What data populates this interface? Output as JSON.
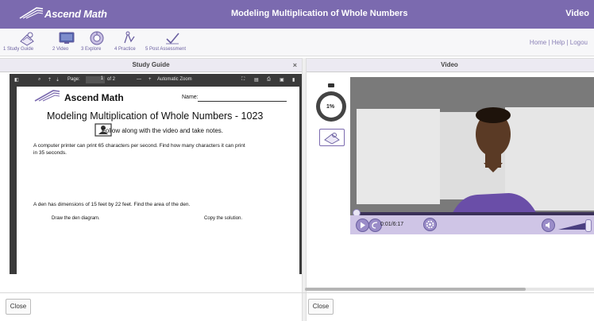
{
  "header": {
    "brand": "Ascend Math",
    "lesson_title": "Modeling Multiplication of Whole Numbers",
    "right_label": "Video"
  },
  "steps": [
    {
      "label": "1 Study Guide"
    },
    {
      "label": "2 Video"
    },
    {
      "label": "3 Explore"
    },
    {
      "label": "4 Practice"
    },
    {
      "label": "5 Post Assessment"
    }
  ],
  "toplinks": "Home | Help | Logou",
  "left_panel": {
    "title": "Study Guide",
    "close_x": "×",
    "close_button": "Close"
  },
  "right_panel": {
    "title": "Video",
    "close_button": "Close"
  },
  "pdf_toolbar": {
    "page_label": "Page:",
    "page_value": "1",
    "page_of": "of 2",
    "minus": "—",
    "plus": "+",
    "zoom": "Automatic Zoom"
  },
  "document": {
    "brand": "Ascend Math",
    "name_label": "Name:",
    "title": "Modeling Multiplication of Whole Numbers - 1023",
    "follow": "Follow along with the video and take notes.",
    "problem1_line1": "A computer printer can print 65 characters per second. Find how many characters it can print",
    "problem1_line2": "in 35 seconds.",
    "problem2": "A den has dimensions of 15 feet by 22 feet. Find the area of the den.",
    "draw": "Draw the den diagram.",
    "copy": "Copy the solution."
  },
  "timer": {
    "percent": "1%"
  },
  "video": {
    "time": "0:01/6:17",
    "progress": 0.003,
    "volume_level": 0.9
  }
}
